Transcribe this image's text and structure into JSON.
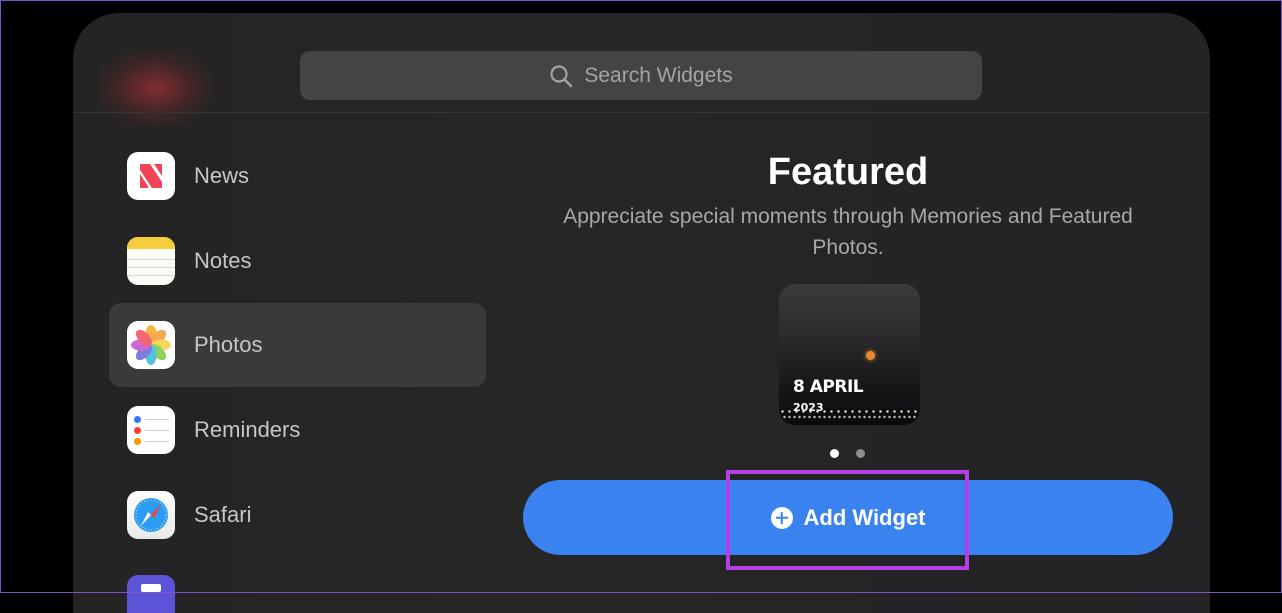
{
  "search": {
    "placeholder": "Search Widgets",
    "icon": "magnifier-icon"
  },
  "sidebar": {
    "items": [
      {
        "label": "News",
        "icon": "news-icon",
        "selected": false
      },
      {
        "label": "Notes",
        "icon": "notes-icon",
        "selected": false
      },
      {
        "label": "Photos",
        "icon": "photos-icon",
        "selected": true
      },
      {
        "label": "Reminders",
        "icon": "reminders-icon",
        "selected": false
      },
      {
        "label": "Safari",
        "icon": "safari-icon",
        "selected": false
      }
    ]
  },
  "featured": {
    "title": "Featured",
    "description": "Appreciate special moments through Memories and Featured Photos.",
    "preview": {
      "date": "8 APRIL",
      "year": "2023"
    },
    "pagination": {
      "total": 2,
      "active": 1
    }
  },
  "add_widget": {
    "label": "Add Widget",
    "icon": "plus-circle-icon"
  },
  "colors": {
    "panel_bg": "#262626",
    "accent_blue": "#3a82f0",
    "highlight": "#b43ee6",
    "selected_row": "#3a3a3c"
  }
}
